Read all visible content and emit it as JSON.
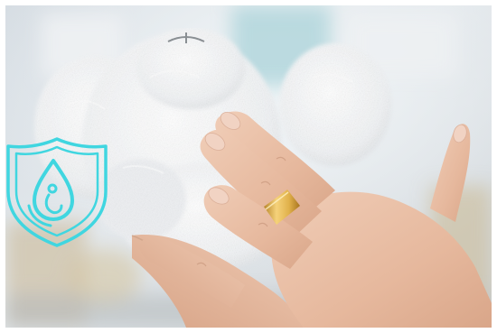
{
  "scene": {
    "subject": "hands-on-white-fluffy-toy",
    "accent_color": "#40d6e0",
    "ring_color": "#e0b04a",
    "fur_color": "#f4f6f8",
    "skin_color": "#e9c1a8"
  },
  "overlay": {
    "icon": "water-drop-shield-icon"
  }
}
